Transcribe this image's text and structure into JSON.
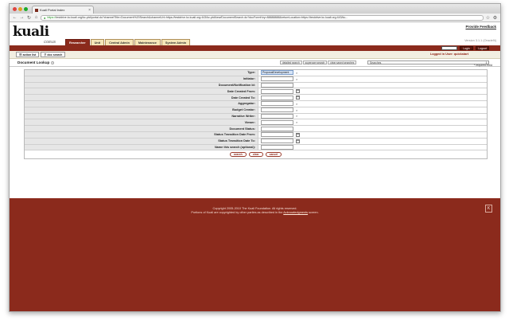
{
  "browser": {
    "tab_title": "Kuali Portal Index",
    "tab_close": "×",
    "url_prefix": "https://",
    "url_rest": "testdrive.kc.kuali.org/kc-ptd/portal.do?channelTitle=Document%20Search&channelUrl=https://testdrive.kc.kuali.org:443/kc-ptd/kew/DocumentSearch.do?docFormKey=88888888&returnLocation=https://testdrive.kc.kuali.org:443/kc...",
    "back_icon": "←",
    "forward_icon": "→",
    "reload_icon": "↻",
    "home_icon": "⌂",
    "star_icon": "☆",
    "wrench_icon": "⚙"
  },
  "header": {
    "logo": "kuali",
    "product": "COEUS",
    "provide_feedback": "Provide Feedback",
    "version": "Version 3.1.1 (Oracle9i)",
    "tabs": [
      {
        "label": "Researcher",
        "active": true
      },
      {
        "label": "Unit",
        "active": false
      },
      {
        "label": "Central Admin",
        "active": false
      },
      {
        "label": "Maintenance",
        "active": false
      },
      {
        "label": "System Admin",
        "active": false
      }
    ]
  },
  "login": {
    "login_button": "Login",
    "logout_button": "Logout",
    "logged_in_text": "Logged in User: quickstart"
  },
  "actions": {
    "action_list": "action list",
    "doc_search": "doc search"
  },
  "lookup": {
    "title": "Document Lookup",
    "help_icon": "?",
    "detailed_search": "detailed search",
    "superuser_search": "superuser search",
    "clear_saved_searches": "clear saved searches",
    "saved_searches": "Searches",
    "required_note": "* required field"
  },
  "form": {
    "rows": [
      {
        "label": "Type:",
        "value": "ProposalDevelopment",
        "icon": "lookup"
      },
      {
        "label": "Initiator:",
        "value": "",
        "icon": "lookup"
      },
      {
        "label": "Document/Notification Id:",
        "value": "",
        "icon": "none"
      },
      {
        "label": "Date Created From:",
        "value": "",
        "icon": "calendar"
      },
      {
        "label": "Date Created To:",
        "value": "",
        "icon": "calendar"
      },
      {
        "label": "Aggregator:",
        "value": "",
        "icon": "lookup"
      },
      {
        "label": "Budget Creator:",
        "value": "",
        "icon": "lookup"
      },
      {
        "label": "Narrative Writer:",
        "value": "",
        "icon": "lookup"
      },
      {
        "label": "Viewer:",
        "value": "",
        "icon": "lookup"
      },
      {
        "label": "Document Status:",
        "value": "",
        "icon": "none"
      },
      {
        "label": "Status Transition Date From:",
        "value": "",
        "icon": "calendar"
      },
      {
        "label": "Status Transition Date To:",
        "value": "",
        "icon": "calendar"
      },
      {
        "label": "Name this search (optional):",
        "value": "",
        "icon": "none"
      }
    ],
    "search_button": "search",
    "clear_button": "clear",
    "cancel_button": "cancel"
  },
  "footer": {
    "line1": "Copyright 2005-2010 The Kuali Foundation. All rights reserved.",
    "line2_pre": "Portions of Kuali are copyrighted by other parties as described in the",
    "line2_link": "Acknowledgments",
    "line2_post": "screen."
  },
  "colors": {
    "brand_red": "#8b2a1c",
    "tab_tan": "#f5e6b8"
  }
}
